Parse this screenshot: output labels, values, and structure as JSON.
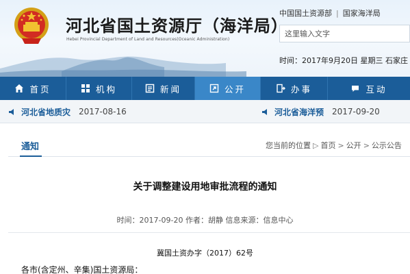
{
  "header": {
    "title": "河北省国土资源厅（海洋局）",
    "subtitle": "Hebei Provincial  Department of Land and Resources(Oceanic Administration)",
    "top_links": [
      "中国国土资源部",
      "国家海洋局"
    ],
    "search_placeholder": "这里输入文字",
    "date_text": "时间：2017年9月20日 星期三",
    "location": "石家庄"
  },
  "nav": {
    "items": [
      {
        "label": "首页",
        "icon": "home-icon"
      },
      {
        "label": "机构",
        "icon": "org-icon"
      },
      {
        "label": "新闻",
        "icon": "news-icon"
      },
      {
        "label": "公开",
        "icon": "open-icon",
        "active": true
      },
      {
        "label": "办事",
        "icon": "service-icon"
      },
      {
        "label": "互动",
        "icon": "interact-icon"
      }
    ]
  },
  "ticker": {
    "items": [
      {
        "label": "河北省地质灾",
        "date": "2017-08-16"
      },
      {
        "label": "河北省海洋预",
        "date": "2017-09-20"
      }
    ]
  },
  "section": {
    "title": "通知",
    "breadcrumb_prefix": "您当前的位置",
    "breadcrumb": [
      "首页",
      "公开",
      "公示公告"
    ]
  },
  "article": {
    "title": "关于调整建设用地审批流程的通知",
    "meta": "时间：2017-09-20 作者：胡静 信息来源：信息中心",
    "doc_no": "冀国土资办字（2017）62号",
    "salutation": "各市(含定州、辛集)国土资源局："
  },
  "colors": {
    "nav_bg": "#1b5d99",
    "nav_active": "#3a87c8",
    "link": "#1b5d99"
  }
}
